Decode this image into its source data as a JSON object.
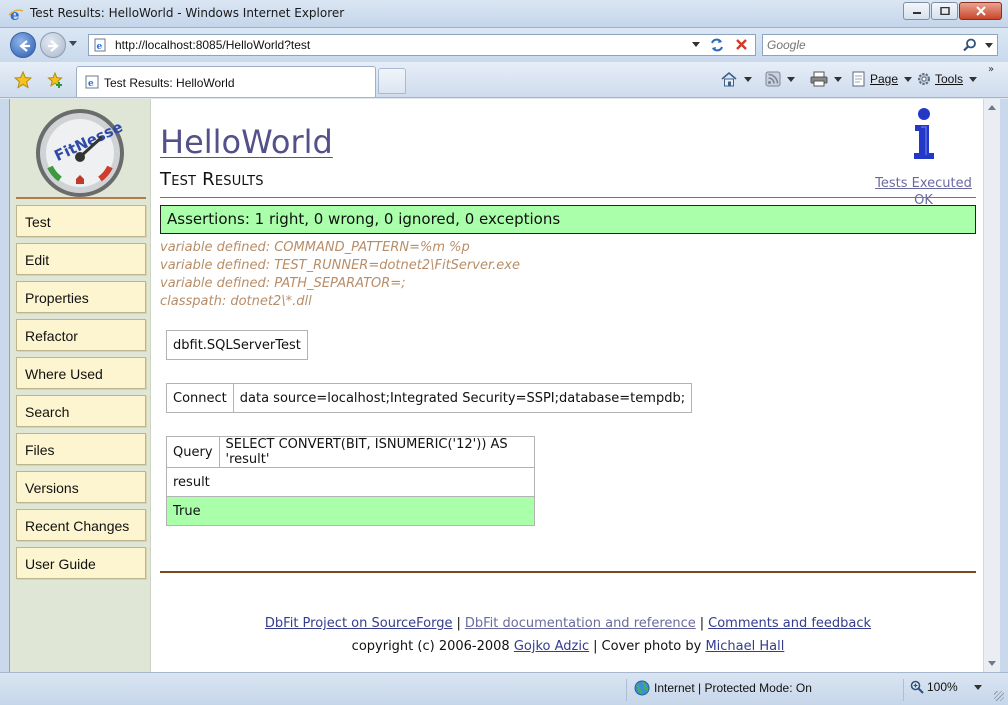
{
  "window": {
    "title": "Test Results: HelloWorld - Windows Internet Explorer"
  },
  "navbar": {
    "url": "http://localhost:8085/HelloWorld?test",
    "search_placeholder": "Google"
  },
  "tabbar": {
    "tab_label": "Test Results: HelloWorld",
    "page_label": "Page",
    "tools_label": "Tools"
  },
  "sidebar": {
    "items": [
      {
        "label": "Test"
      },
      {
        "label": "Edit"
      },
      {
        "label": "Properties"
      },
      {
        "label": "Refactor"
      },
      {
        "label": "Where Used"
      },
      {
        "label": "Search"
      },
      {
        "label": "Files"
      },
      {
        "label": "Versions"
      },
      {
        "label": "Recent Changes"
      },
      {
        "label": "User Guide"
      }
    ]
  },
  "page": {
    "title": "HelloWorld",
    "subtitle": "Test Results",
    "exec_link_line1": "Tests Executed",
    "exec_link_line2": "OK",
    "assertions": "Assertions: 1 right, 0 wrong, 0 ignored, 0 exceptions",
    "variables": [
      "variable defined: COMMAND_PATTERN=%m %p",
      "variable defined: TEST_RUNNER=dotnet2\\FitServer.exe",
      "variable defined: PATH_SEPARATOR=;",
      "classpath: dotnet2\\*.dll"
    ],
    "fixture_table": "dbfit.SQLServerTest",
    "connect_table": {
      "keyword": "Connect",
      "value": "data source=localhost;Integrated Security=SSPI;database=tempdb;"
    },
    "query_table": {
      "keyword": "Query",
      "sql": "SELECT CONVERT(BIT, ISNUMERIC('12')) AS 'result'",
      "column": "result",
      "value": "True"
    }
  },
  "footer": {
    "link1": "DbFit Project on SourceForge",
    "link2": "DbFit documentation and reference",
    "link3": "Comments and feedback",
    "sep": "|",
    "copyright_prefix": "copyright (c) 2006-2008",
    "author": "Gojko Adzic",
    "cover_prefix": "Cover photo by",
    "photographer": "Michael Hall"
  },
  "statusbar": {
    "zone": "Internet | Protected Mode: On",
    "zoom": "100%"
  },
  "colors": {
    "pass_green": "#aaffaa",
    "sidebar_button": "#fdf5d0",
    "title_link": "#54508a",
    "variable_text": "#b88d68",
    "rule_brown": "#7a4b22"
  },
  "icons": [
    "ie-icon",
    "minimize-icon",
    "maximize-icon",
    "close-icon",
    "back-icon",
    "forward-icon",
    "page-icon",
    "refresh-icon",
    "stop-icon",
    "search-icon",
    "favorites-star-icon",
    "add-favorites-icon",
    "tab-ie-icon",
    "home-icon",
    "feeds-icon",
    "print-icon",
    "page-menu-icon",
    "tools-gear-icon",
    "fitnesse-logo",
    "info-icon",
    "globe-icon",
    "zoom-icon"
  ]
}
